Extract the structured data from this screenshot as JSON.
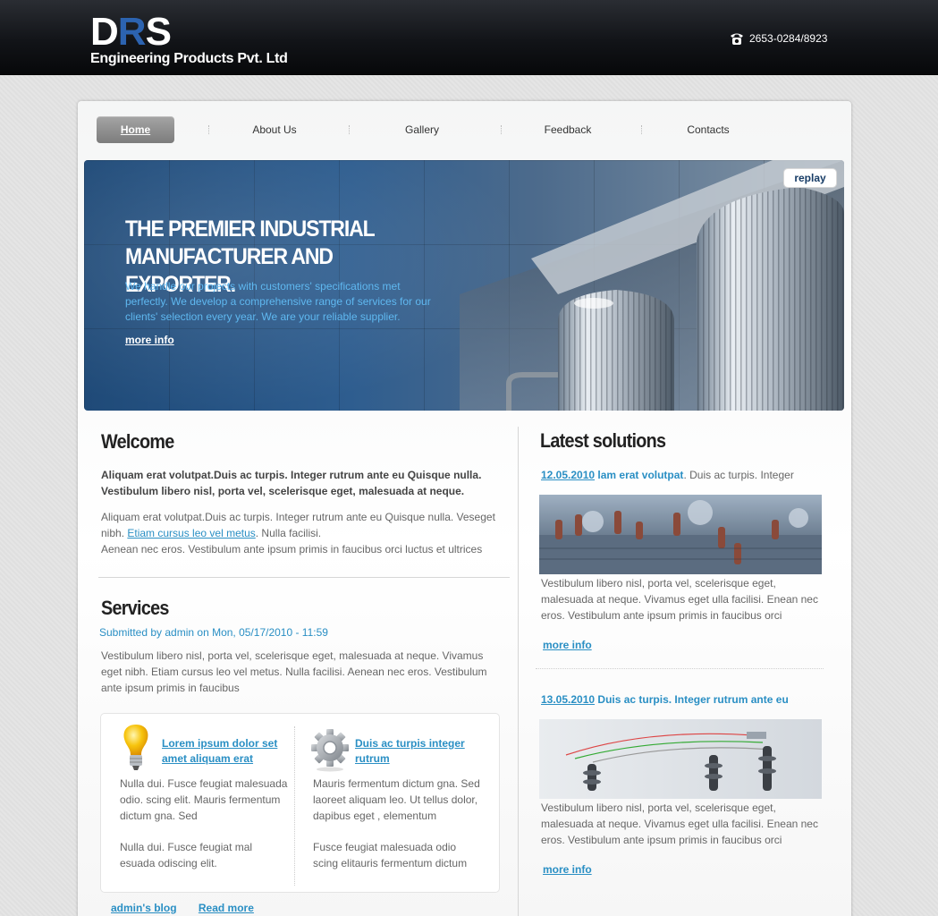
{
  "header": {
    "logo_text": "DRS",
    "logo_sub": "Engineering Products Pvt. Ltd",
    "phone": "2653-0284/8923"
  },
  "nav": {
    "items": [
      {
        "label": "Home",
        "active": true
      },
      {
        "label": "About Us",
        "active": false
      },
      {
        "label": "Gallery",
        "active": false
      },
      {
        "label": "Feedback",
        "active": false
      },
      {
        "label": "Contacts",
        "active": false
      }
    ]
  },
  "banner": {
    "headline_line1": "THE PREMIER INDUSTRIAL",
    "headline_line2": "MANUFACTURER AND EXPORTER.",
    "description": "We handle our projects with  customers' specifications met perfectly. We develop a comprehensive range of services for our clients' selection every year. We are your reliable supplier.",
    "more_link": "more info",
    "replay_label": "replay"
  },
  "welcome": {
    "title": "Welcome",
    "lead": "Aliquam erat volutpat.Duis ac turpis. Integer rutrum ante eu Quisque nulla. Vestibulum libero nisl, porta vel, scelerisque eget, malesuada at neque.",
    "body_before_link": "Aliquam erat volutpat.Duis ac turpis. Integer rutrum ante eu Quisque nulla. Veseget nibh.",
    "body_link": "Etiam cursus leo vel metus",
    "body_after_link": ". Nulla facilisi.",
    "body_line2": "Aenean nec eros. Vestibulum ante ipsum primis in faucibus orci luctus et ultrices"
  },
  "services": {
    "title": "Services",
    "meta": "Submitted by admin on Mon, 05/17/2010 - 11:59",
    "body": "Vestibulum libero nisl, porta vel, scelerisque eget, malesuada at neque. Vivamus eget nibh. Etiam cursus leo vel metus. Nulla facilisi. Aenean nec eros. Vestibulum ante ipsum primis in faucibus",
    "items": [
      {
        "icon": "lightbulb-icon",
        "title": "Lorem ipsum dolor set amet aliquam erat",
        "text1": "Nulla dui. Fusce feugiat malesuada odio. scing elit. Mauris fermentum dictum gna. Sed",
        "text2": "Nulla dui. Fusce feugiat mal esuada odiscing elit."
      },
      {
        "icon": "gear-icon",
        "title": "Duis ac turpis integer rutrum",
        "text1": "Mauris fermentum dictum gna. Sed laoreet aliquam leo. Ut tellus dolor, dapibus eget , elementum",
        "text2": "Fusce feugiat malesuada odio scing elitauris fermentum dictum"
      }
    ],
    "footer_links": [
      "admin's blog",
      "Read more"
    ]
  },
  "latest": {
    "title": "Latest solutions",
    "items": [
      {
        "date": "12.05.2010",
        "title": "lam erat volutpat",
        "rest": ". Duis ac turpis. Integer",
        "text": "Vestibulum libero nisl, porta vel, scelerisque eget, malesuada at neque. Vivamus eget ulla facilisi. Enean nec eros. Vestibulum ante ipsum primis in faucibus orci",
        "more": "more info"
      },
      {
        "date": "13.05.2010",
        "title": " Duis ac turpis. Integer rutrum ante eu",
        "rest": "",
        "text": "Vestibulum libero nisl, porta vel, scelerisque eget, malesuada at neque. Vivamus eget ulla facilisi. Enean nec eros. Vestibulum ante ipsum primis in faucibus orci",
        "more": "more info"
      }
    ]
  },
  "colors": {
    "accent": "#2a8fc4",
    "logo_r": "#2c63b0",
    "banner_text": "#5fb8f0"
  }
}
